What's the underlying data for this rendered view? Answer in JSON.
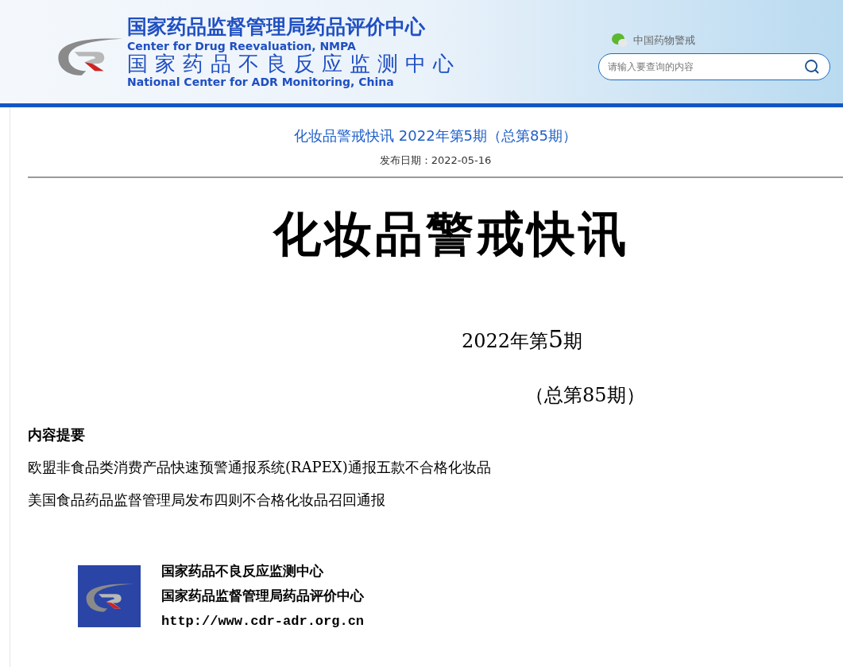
{
  "header": {
    "title_cn": "国家药品监督管理局药品评价中心",
    "title_en": "Center for Drug Reevaluation, NMPA",
    "subtitle_cn": "国家药品不良反应监测中心",
    "subtitle_en": "National Center for ADR Monitoring, China",
    "wechat_label": "中国药物警戒",
    "search": {
      "placeholder": "请输入要查询的内容"
    }
  },
  "article": {
    "title": "化妆品警戒快讯 2022年第5期（总第85期）",
    "date": "发布日期：2022-05-16"
  },
  "document": {
    "heading": "化妆品警戒快讯",
    "issue_year": "2022年第",
    "issue_no": "5",
    "issue_suffix": "期",
    "total": "（总第85期）",
    "summary_title": "内容提要",
    "summary_items": [
      "欧盟非食品类消费产品快速预警通报系统(RAPEX)通报五款不合格化妆品",
      "美国食品药品监督管理局发布四则不合格化妆品召回通报"
    ]
  },
  "footer": {
    "lines": [
      "国家药品不良反应监测中心",
      "国家药品监督管理局药品评价中心"
    ],
    "url": "http://www.cdr-adr.org.cn"
  }
}
